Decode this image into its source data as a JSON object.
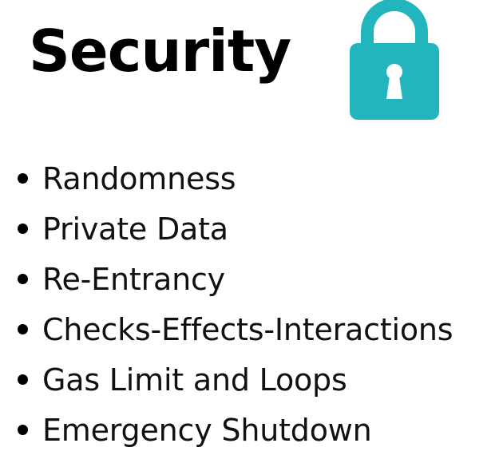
{
  "title": "Security",
  "icon": {
    "name": "lock-icon",
    "color": "#23B5BE"
  },
  "items": [
    {
      "label": "Randomness"
    },
    {
      "label": "Private Data"
    },
    {
      "label": "Re-Entrancy"
    },
    {
      "label": "Checks-Effects-Interactions"
    },
    {
      "label": "Gas Limit and Loops"
    },
    {
      "label": "Emergency Shutdown"
    }
  ]
}
